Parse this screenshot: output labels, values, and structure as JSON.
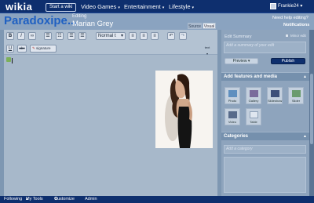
{
  "topbar": {
    "logo": "wikia",
    "start_wiki": "Start a wiki",
    "nav": [
      "Video Games",
      "Entertainment",
      "Lifestyle"
    ],
    "username": "Frankie24"
  },
  "header": {
    "wiki_name": "Paradoxipe...",
    "editing_label": "Editing",
    "page_name": "Marian Grey",
    "need_help": "Need help editing?",
    "notifications": "Notifications",
    "tabs": [
      "Source",
      "Visual"
    ]
  },
  "toolbar": {
    "format_select": "Normal t",
    "signature": "signature",
    "text_label": "text"
  },
  "sidebar": {
    "edit_summary_label": "Edit Summary",
    "minor_edit_label": "Minor edit",
    "summary_placeholder": "Add a summary of your edit",
    "preview_label": "Preview",
    "publish_label": "Publish",
    "features_title": "Add features and media",
    "features": [
      "Photo",
      "Gallery",
      "Slideshow",
      "Slider",
      "Video",
      "Table"
    ],
    "categories_title": "Categories",
    "category_placeholder": "Add a category"
  },
  "footer": {
    "items": [
      "Following",
      "My Tools",
      "Customize",
      "Admin"
    ]
  },
  "colors": {
    "topbar": "#0e2f6e",
    "wiki_name": "#1f60c2",
    "publish": "#0e2f6e"
  }
}
